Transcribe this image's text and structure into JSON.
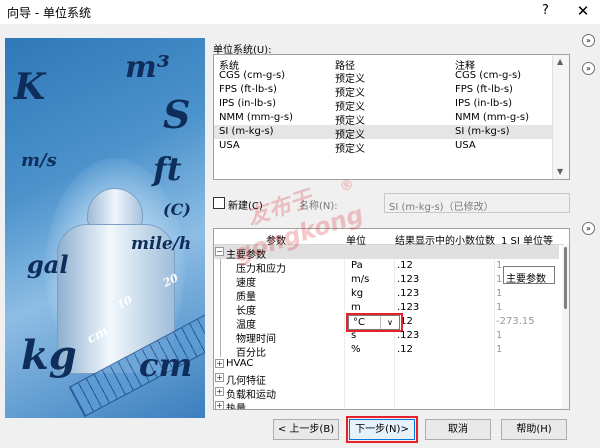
{
  "window": {
    "title": "向导 - 单位系统",
    "help_icon": "?",
    "close_icon": "✕"
  },
  "side_image": {
    "units": [
      "K",
      "m³",
      "S",
      "m/s",
      "ft",
      "(C)",
      "mile/h",
      "gal",
      "kg",
      "cm",
      "cm",
      "10",
      "20"
    ]
  },
  "units_list": {
    "label": "单位系统(U):",
    "columns": [
      "系统",
      "路径",
      "注释"
    ],
    "rows": [
      [
        "CGS (cm-g-s)",
        "预定义",
        "CGS (cm-g-s)"
      ],
      [
        "FPS (ft-lb-s)",
        "预定义",
        "FPS (ft-lb-s)"
      ],
      [
        "IPS (in-lb-s)",
        "预定义",
        "IPS (in-lb-s)"
      ],
      [
        "NMM (mm-g-s)",
        "预定义",
        "NMM (mm-g-s)"
      ],
      [
        "SI (m-kg-s)",
        "预定义",
        "SI (m-kg-s)"
      ],
      [
        "USA",
        "预定义",
        "USA"
      ]
    ],
    "selected_index": 4
  },
  "new_row": {
    "checkbox_label": "新建(C)",
    "name_label": "名称(N):",
    "name_value": "SI (m-kg-s)（已修改）"
  },
  "params": {
    "columns": [
      "参数",
      "单位",
      "结果显示中的小数位数",
      "1 SI 单位等"
    ],
    "group_label": "主要参数",
    "rows": [
      {
        "name": "压力和应力",
        "unit": "Pa",
        "decimals": ".12",
        "si": "1"
      },
      {
        "name": "速度",
        "unit": "m/s",
        "decimals": ".123",
        "si": "1"
      },
      {
        "name": "质量",
        "unit": "kg",
        "decimals": ".123",
        "si": "1"
      },
      {
        "name": "长度",
        "unit": "m",
        "decimals": ".123",
        "si": "1"
      },
      {
        "name": "温度",
        "unit": "°C",
        "decimals": ".12",
        "si": "-273.15"
      },
      {
        "name": "物理时间",
        "unit": "s",
        "decimals": ".123",
        "si": "1"
      },
      {
        "name": "百分比",
        "unit": "%",
        "decimals": ".12",
        "si": "1"
      }
    ],
    "collapsed_groups": [
      "HVAC",
      "几何特征",
      "负载和运动",
      "热量"
    ]
  },
  "tooltip": "主要参数",
  "buttons": {
    "back": "< 上一步(B)",
    "next": "下一步(N)>",
    "cancel": "取消",
    "help": "帮助(H)"
  },
  "watermark": [
    "友布于",
    "gongkong",
    "®"
  ]
}
